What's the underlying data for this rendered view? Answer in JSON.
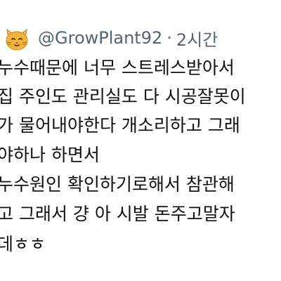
{
  "tweet": {
    "handle": "@GrowPlant92",
    "separator": "·",
    "time": "2시간",
    "avatar_icon": "cat-face-icon",
    "avatar_color": "#f4b43a",
    "lines": [
      "누수때문에 너무 스트레스받아서",
      "집 주인도 관리실도 다 시공잘못이",
      "가 물어내야한다 개소리하고 그래",
      "야하나 하면서",
      "누수원인 확인하기로해서 참관해",
      "고 그래서 걍 아 시발 돈주고말자",
      "데ㅎㅎ"
    ]
  }
}
